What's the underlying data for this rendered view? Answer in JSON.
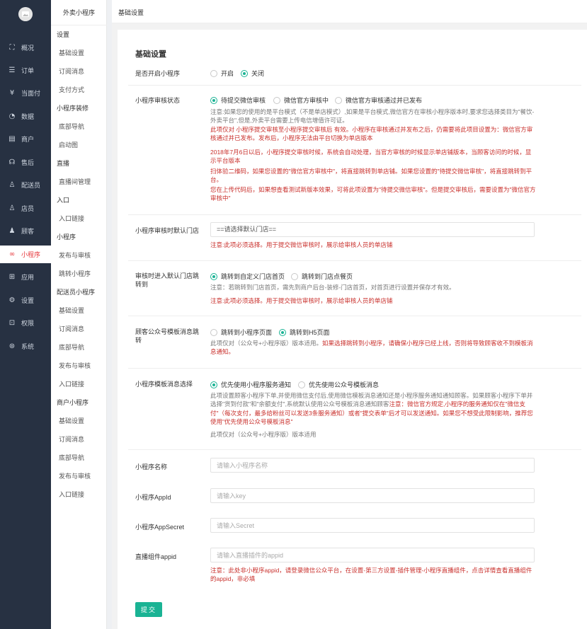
{
  "colors": {
    "accent": "#1ab394",
    "danger": "#c9302c",
    "nav_bg": "#273142"
  },
  "nav": {
    "items": [
      {
        "label": "概况",
        "icon": "scan-icon"
      },
      {
        "label": "订单",
        "icon": "list-icon"
      },
      {
        "label": "当面付",
        "icon": "yen-icon"
      },
      {
        "label": "数据",
        "icon": "chart-icon"
      },
      {
        "label": "商户",
        "icon": "store-icon"
      },
      {
        "label": "售后",
        "icon": "headset-icon"
      },
      {
        "label": "配送员",
        "icon": "user-icon"
      },
      {
        "label": "店员",
        "icon": "staff-icon"
      },
      {
        "label": "顾客",
        "icon": "customer-icon"
      },
      {
        "label": "小程序",
        "icon": "miniprogram-icon"
      },
      {
        "label": "应用",
        "icon": "apps-icon"
      },
      {
        "label": "设置",
        "icon": "gear-icon"
      },
      {
        "label": "权限",
        "icon": "lock-icon"
      },
      {
        "label": "系统",
        "icon": "system-icon"
      }
    ]
  },
  "subnav": {
    "title": "外卖小程序",
    "groups": [
      {
        "label": "设置",
        "items": [
          "基础设置",
          "订阅消息",
          "支付方式"
        ]
      },
      {
        "label": "小程序装修",
        "items": [
          "底部导航",
          "启动图"
        ]
      },
      {
        "label": "直播",
        "items": [
          "直播间管理"
        ]
      },
      {
        "label": "入口",
        "items": [
          "入口链接"
        ]
      },
      {
        "label": "小程序",
        "items": [
          "发布与审核",
          "跳转小程序"
        ]
      },
      {
        "label": "配送员小程序",
        "items": [
          "基础设置",
          "订阅消息",
          "底部导航",
          "发布与审核",
          "入口链接"
        ]
      },
      {
        "label": "商户小程序",
        "items": [
          "基础设置",
          "订阅消息",
          "底部导航",
          "发布与审核",
          "入口链接"
        ]
      }
    ]
  },
  "breadcrumb": "基础设置",
  "form": {
    "title": "基础设置",
    "open": {
      "label": "是否开启小程序",
      "options": [
        "开启",
        "关闭"
      ],
      "selected": 1
    },
    "audit_status": {
      "label": "小程序审核状态",
      "options": [
        "待提交微信审核",
        "微信官方审核中",
        "微信官方审核通过并已发布"
      ],
      "selected": 0,
      "note1": "注意:如果您的使用的是平台模式（不是单店模式）,如果是平台模式,微信官方在审核小程序版本时,要求您选择类目为\"餐饮-外卖平台\",但是,外卖平台需要上传电信增值许可证。",
      "note2": "此项仅对 小程序提交审核至小程序提交审核后 有效。小程序在审核通过并发布之后，仍需要将此项目设置为：微信官方审核通过并已发布。发布后，小程序无法由平台切换为单店版本",
      "note3": "2018年7月6日以后，小程序提交审核时候，系统会自动处理，当官方审核的时候显示单店铺版本，当顾客访问的时候，显示平台版本",
      "note4": "扫体验二维码，如果您设置的\"微信官方审核中\"，将直接跳转到单店铺。如果您设置的\"待提交微信审核\"，将直接跳转到平台。",
      "note5": "您在上传代码后，如果想查看测试新版本效果，可将此项设置为\"待提交微信审核\"。但是提交审核后，需要设置为\"微信官方审核中\""
    },
    "audit_store": {
      "label": "小程序审核时默认门店",
      "value": "==请选择默认门店==",
      "note": "注意:此项必须选择。用于提交微信审核时，展示给审核人员的单店铺"
    },
    "audit_jump": {
      "label": "审核时进入默认门店跳转到",
      "options": [
        "跳转到自定义门店首页",
        "跳转到门店点餐页"
      ],
      "selected": 0,
      "note1": "注意：若跳转到门店首页，需先到商户后台-装修-门店首页，对首页进行设置并保存才有效。",
      "note2": "注意:此项必须选择。用于提交微信审核时，展示给审核人员的单店铺"
    },
    "tpl_jump": {
      "label": "顾客公众号模板消息跳转",
      "options": [
        "跳转到小程序页面",
        "跳转到H5页面"
      ],
      "selected": 1,
      "note_gray": "此项仅对（公众号+小程序版）版本适用。",
      "note_red": "如果选择跳转到小程序，请确保小程序已经上线，否则将导致顾客收不到模板消息通知。"
    },
    "tpl_select": {
      "label": "小程序模板消息选择",
      "options": [
        "优先使用小程序服务通知",
        "优先使用公众号模板消息"
      ],
      "selected": 0,
      "note_gray": "此项设置顾客小程序下单,并使用微信支付后,使用微信模板消息通知还是小程序服务通知通知顾客。如果顾客小程序下单并选择\"货到付款\"和\"余额支付\",系统默认使用公众号模板消息通知顾客",
      "note_red": "注意：微信官方规定,小程序的服务通知仅在\"微信支付\"（每次支付，最多给粉丝可以发送3条服务通知）或者\"提交表单\"后才可以发送通知。如果您不想受此限制影响，推荐您使用\"优先使用公众号模板消息\"",
      "note_last": "此项仅对（公众号+小程序版）版本适用"
    },
    "name": {
      "label": "小程序名称",
      "placeholder": "请输入小程序名称"
    },
    "appid": {
      "label": "小程序AppId",
      "placeholder": "请输入key"
    },
    "secret": {
      "label": "小程序AppSecret",
      "placeholder": "请输入Secret"
    },
    "live": {
      "label": "直播组件appid",
      "placeholder": "请输入直播插件的appid",
      "note": "注意：此处非小程序appid，请登录微信公众平台，在设置-第三方设置-插件管理-小程序直播组件，点击详情查看直播组件的appid，非必填"
    },
    "submit": "提交"
  }
}
